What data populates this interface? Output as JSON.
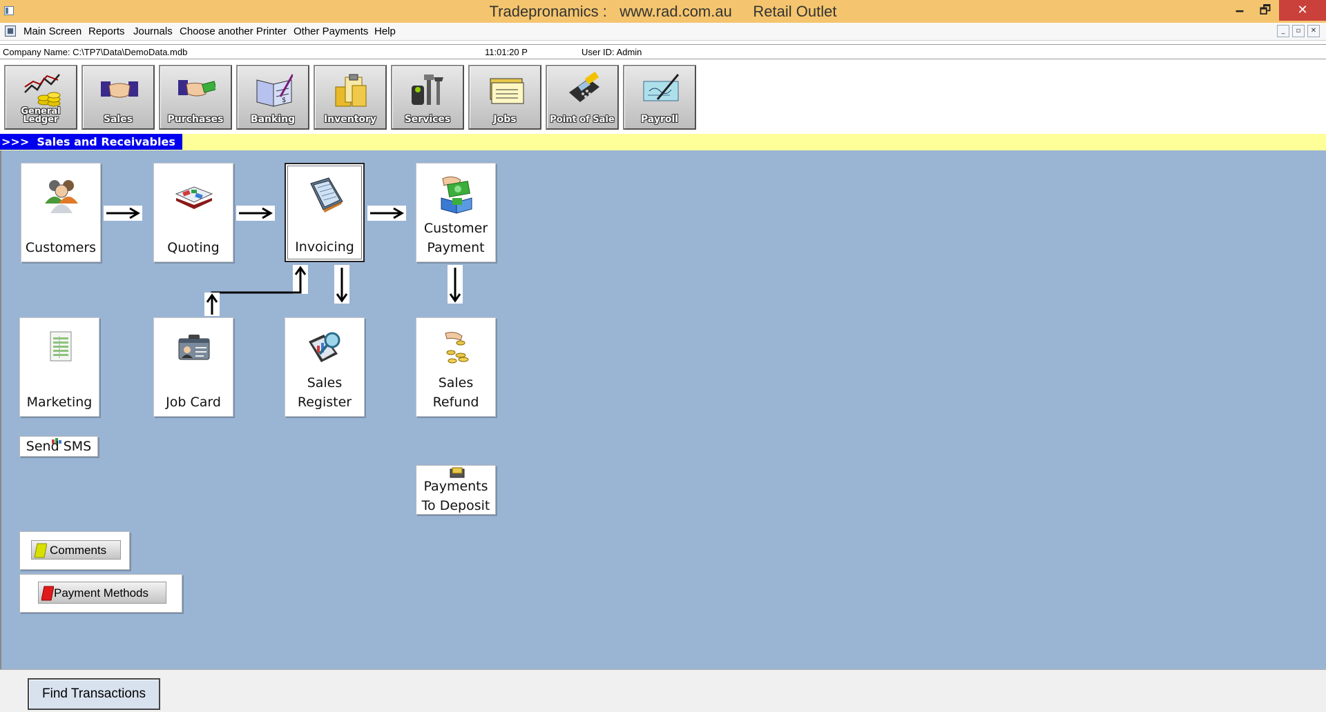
{
  "window": {
    "title": "Tradepronamics :   www.rad.com.au     Retail Outlet",
    "controls": {
      "minimize": "🗕",
      "maximize": "🗗",
      "close": "✕"
    }
  },
  "menu": {
    "items": [
      "Main Screen",
      "Reports",
      "Journals",
      "Choose another Printer",
      "Other Payments",
      "Help"
    ]
  },
  "info": {
    "company": "Company Name: C:\\TP7\\Data\\DemoData.mdb",
    "time": "11:01:20 P",
    "user": "User ID: Admin"
  },
  "toolbar": [
    {
      "label": "General Ledger",
      "icon": "general-ledger-icon"
    },
    {
      "label": "Sales",
      "icon": "handshake-icon"
    },
    {
      "label": "Purchases",
      "icon": "handshake-money-icon"
    },
    {
      "label": "Banking",
      "icon": "cheque-book-icon"
    },
    {
      "label": "Inventory",
      "icon": "clipboard-icon"
    },
    {
      "label": "Services",
      "icon": "tools-icon"
    },
    {
      "label": "Jobs",
      "icon": "cards-icon"
    },
    {
      "label": "Point of Sale",
      "icon": "card-terminal-icon"
    },
    {
      "label": "Payroll",
      "icon": "cheque-pen-icon"
    }
  ],
  "section": {
    "title": ">>>  Sales and Receivables"
  },
  "flow": {
    "customers": "Customers",
    "quoting": "Quoting",
    "invoicing": "Invoicing",
    "customer_payment": "Customer Payment",
    "marketing": "Marketing",
    "job_card": "Job Card",
    "sales_register": "Sales Register",
    "sales_refund": "Sales Refund",
    "send_sms": "Send SMS",
    "payments_to_deposit": "Payments To Deposit",
    "comments": "Comments",
    "payment_methods": "Payment Methods"
  },
  "footer": {
    "find_transactions": "Find Transactions"
  },
  "colors": {
    "titlebar": "#f4c56e",
    "section_bar": "#ffff99",
    "section_title": "#0000ee",
    "panel": "#9ab4d4",
    "close_button": "#c9413a"
  }
}
